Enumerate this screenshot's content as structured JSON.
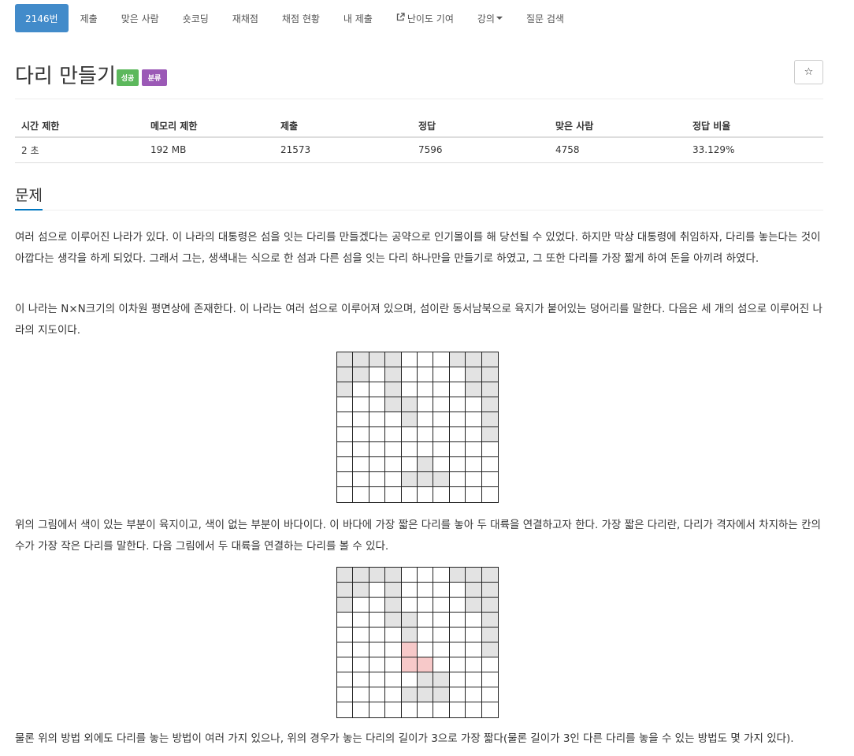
{
  "nav": {
    "tabs": [
      {
        "label": "2146번",
        "active": true
      },
      {
        "label": "제출"
      },
      {
        "label": "맞은 사람"
      },
      {
        "label": "숏코딩"
      },
      {
        "label": "재채점"
      },
      {
        "label": "채점 현황"
      },
      {
        "label": "내 제출"
      },
      {
        "label": "난이도 기여",
        "icon": "external-link-icon"
      },
      {
        "label": "강의",
        "dropdown": true
      },
      {
        "label": "질문 검색"
      }
    ]
  },
  "problem": {
    "title": "다리 만들기",
    "badges": [
      {
        "label": "성공",
        "color": "#5cb85c"
      },
      {
        "label": "분류",
        "color": "#9b59b6"
      }
    ],
    "star": "☆"
  },
  "info": {
    "headers": [
      "시간 제한",
      "메모리 제한",
      "제출",
      "정답",
      "맞은 사람",
      "정답 비율"
    ],
    "values": [
      "2 초",
      "192 MB",
      "21573",
      "7596",
      "4758",
      "33.129%"
    ]
  },
  "section": {
    "title": "문제"
  },
  "paragraphs": [
    "여러 섬으로 이루어진 나라가 있다. 이 나라의 대통령은 섬을 잇는 다리를 만들겠다는 공약으로 인기몰이를 해 당선될 수 있었다. 하지만 막상 대통령에 취임하자, 다리를 놓는다는 것이 아깝다는 생각을 하게 되었다. 그래서 그는, 생색내는 식으로 한 섬과 다른 섬을 잇는 다리 하나만을 만들기로 하였고, 그 또한 다리를 가장 짧게 하여 돈을 아끼려 하였다.",
    "이 나라는 N×N크기의 이차원 평면상에 존재한다. 이 나라는 여러 섬으로 이루어져 있으며, 섬이란 동서남북으로 육지가 붙어있는 덩어리를 말한다. 다음은 세 개의 섬으로 이루어진 나라의 지도이다.",
    "위의 그림에서 색이 있는 부분이 육지이고, 색이 없는 부분이 바다이다. 이 바다에 가장 짧은 다리를 놓아 두 대륙을 연결하고자 한다. 가장 짧은 다리란, 다리가 격자에서 차지하는 칸의 수가 가장 작은 다리를 말한다. 다음 그림에서 두 대륙을 연결하는 다리를 볼 수 있다.",
    "물론 위의 방법 외에도 다리를 놓는 방법이 여러 가지 있으나, 위의 경우가 놓는 다리의 길이가 3으로 가장 짧다(물론 길이가 3인 다른 다리를 놓을 수 있는 방법도 몇 가지 있다)."
  ],
  "figures": {
    "map1": [
      "1111000111",
      "1101000011",
      "1001000011",
      "0001100001",
      "0000100001",
      "0000000001",
      "0000000000",
      "0000010000",
      "0000111000",
      "0000000000"
    ],
    "map2": [
      "1111000111",
      "1101000011",
      "1001000011",
      "0001100001",
      "0000100001",
      "0000200001",
      "0000220000",
      "0000011000",
      "0000111000",
      "0000000000"
    ]
  },
  "colors": {
    "active_tab": "#428bca",
    "land": "#e3e3e3",
    "bridge": "#f7c9c9",
    "section_underline": "#0076c0"
  }
}
